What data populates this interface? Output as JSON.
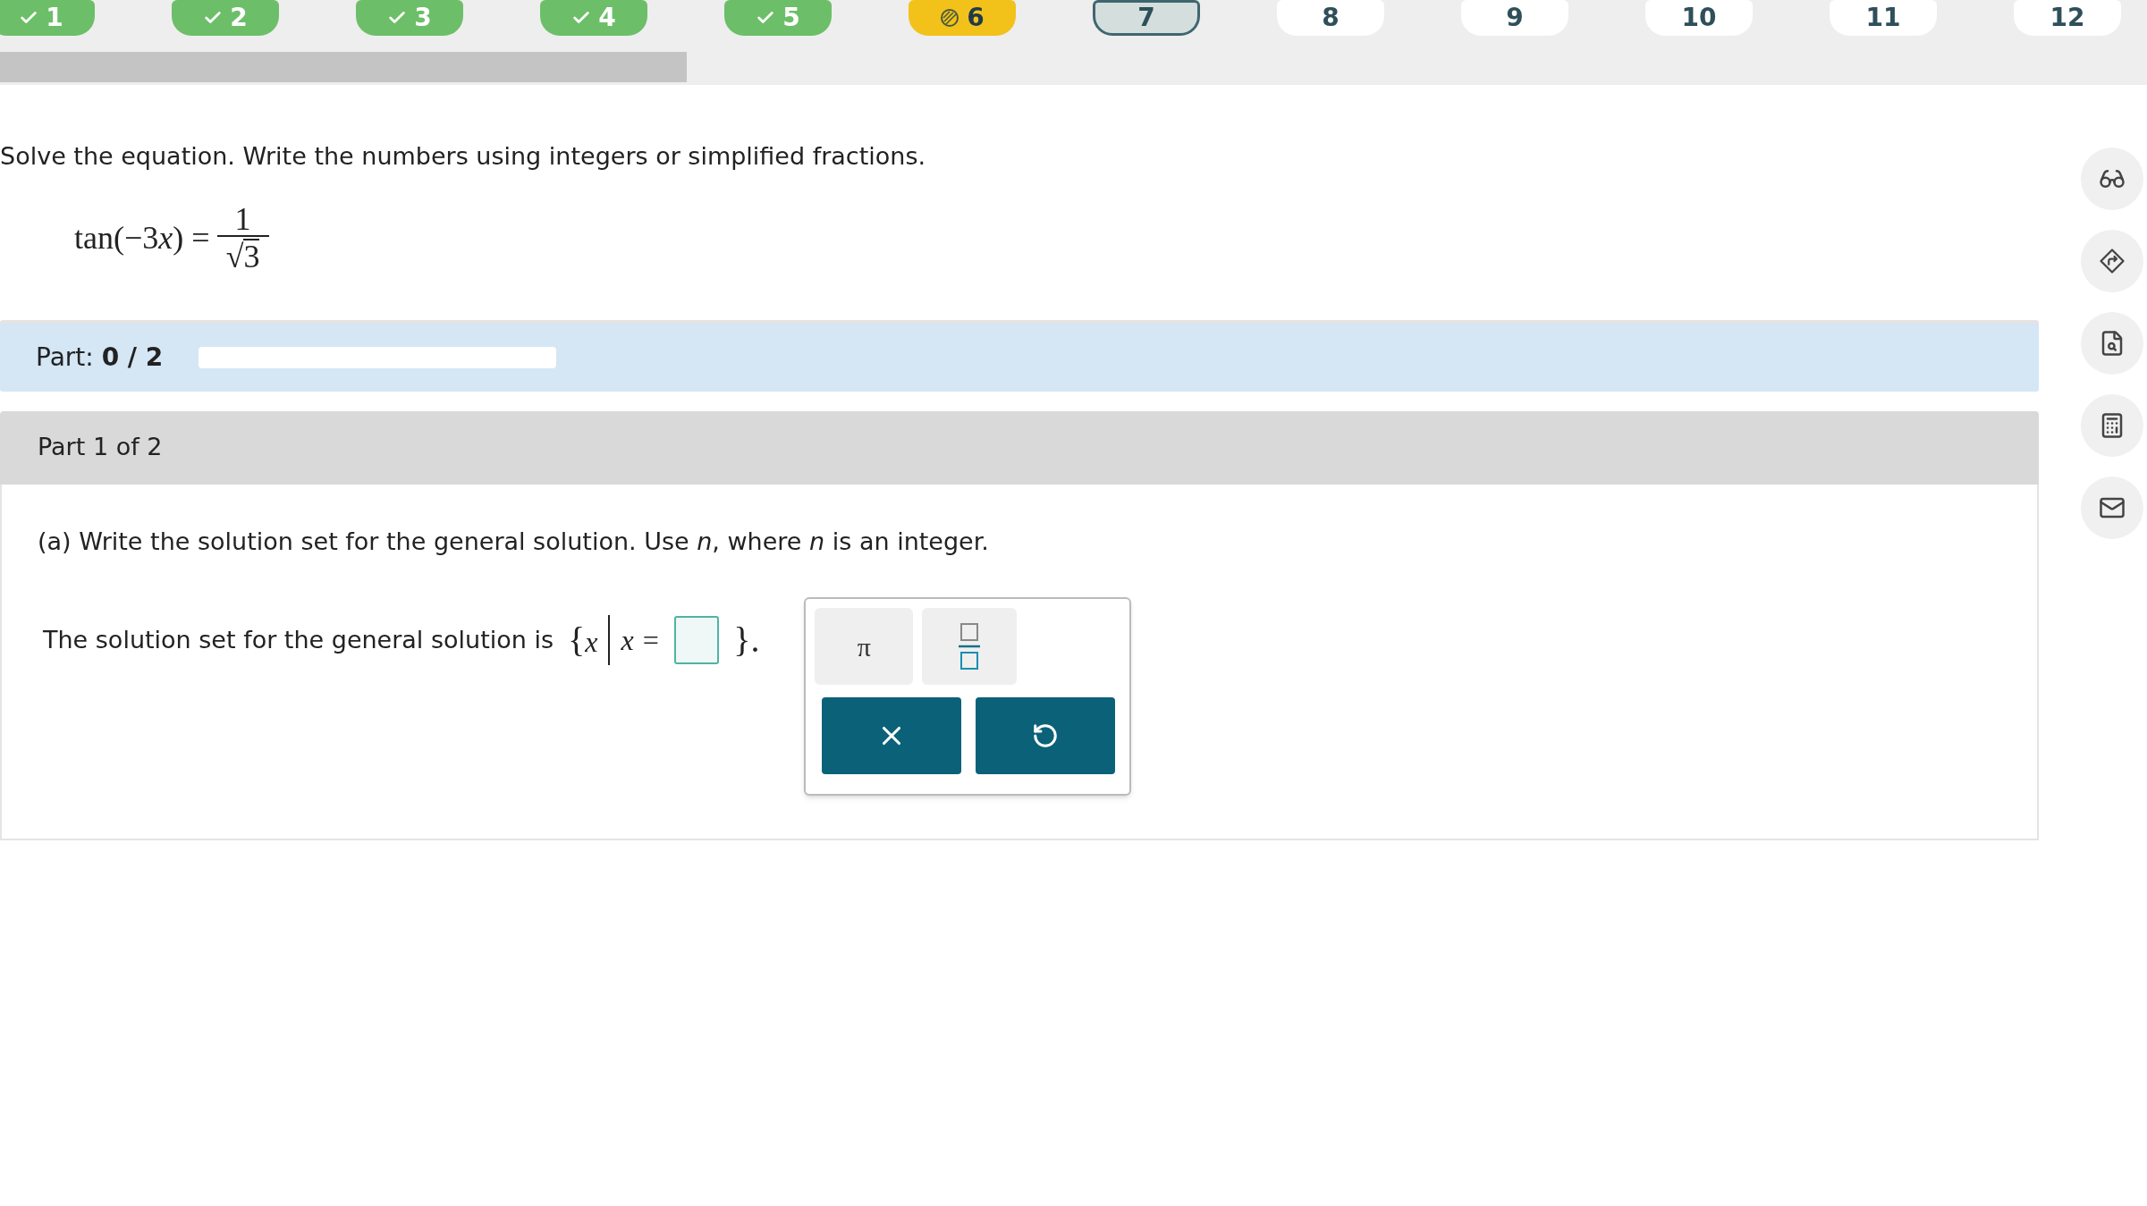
{
  "question_nav": {
    "items": [
      {
        "label": "1",
        "kind": "done",
        "selected": false
      },
      {
        "label": "2",
        "kind": "done",
        "selected": false
      },
      {
        "label": "3",
        "kind": "done",
        "selected": false
      },
      {
        "label": "4",
        "kind": "done",
        "selected": false
      },
      {
        "label": "5",
        "kind": "done",
        "selected": false
      },
      {
        "label": "6",
        "kind": "partial",
        "selected": false
      },
      {
        "label": "7",
        "kind": "todo",
        "selected": true
      },
      {
        "label": "8",
        "kind": "todo",
        "selected": false
      },
      {
        "label": "9",
        "kind": "todo",
        "selected": false
      },
      {
        "label": "10",
        "kind": "todo",
        "selected": false
      },
      {
        "label": "11",
        "kind": "todo",
        "selected": false
      },
      {
        "label": "12",
        "kind": "todo",
        "selected": false
      }
    ],
    "progress": {
      "level": 0.32
    }
  },
  "instructions": "Solve the equation. Write the numbers using integers or simplified fractions.",
  "equation": {
    "function": "tan",
    "open": "(",
    "coefficient": "−3",
    "variable": "x",
    "close": ")",
    "equals": "=",
    "numerator": "1",
    "radical": "√",
    "radicand": "3"
  },
  "part_progress": {
    "label": "Part:",
    "value": "0 / 2",
    "level": 0
  },
  "part_header": "Part 1 of 2",
  "prompt": "(a) Write the solution set for the general solution. Use *n*, where *n* is an integer.",
  "answer_line": {
    "text": "The solution set for the general solution is",
    "open_brace": "{",
    "variable": "x",
    "condition": "x =",
    "close_brace": "}",
    "period": "."
  },
  "keypad": {
    "keys": [
      {
        "label": "π",
        "kind": "symbol"
      },
      {
        "kind": "fraction"
      }
    ],
    "actions": [
      {
        "kind": "clear"
      },
      {
        "kind": "undo"
      }
    ]
  },
  "side_tools": [
    {
      "kind": "glasses"
    },
    {
      "kind": "directions"
    },
    {
      "kind": "search-doc"
    },
    {
      "kind": "calculator"
    },
    {
      "kind": "mail"
    }
  ]
}
